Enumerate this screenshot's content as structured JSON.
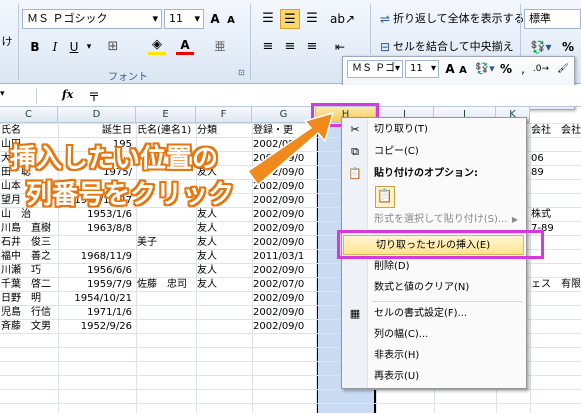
{
  "ribbon": {
    "font_name": "ＭＳ Ｐゴシック",
    "font_size": "11",
    "font_group_label": "フォント",
    "wrap_text_label": "折り返して全体を表示する",
    "merge_center_label": "セルを結合して中央揃え",
    "number_format": "標準",
    "bold": "B",
    "italic": "I",
    "underline": "U",
    "grow_font": "A",
    "shrink_font": "A",
    "font_color_glyph": "A",
    "side_label": "け"
  },
  "formula_bar": {
    "fx": "fx",
    "content": "〒"
  },
  "columns": [
    "C",
    "D",
    "E",
    "F",
    "G",
    "H",
    "I",
    "J",
    "K"
  ],
  "rows": [
    {
      "c": "氏名",
      "d": "誕生日",
      "e": "氏名(連名1)",
      "f": "分類",
      "g": "登録・更",
      "i": "",
      "k": "会社",
      "k2": "会社"
    },
    {
      "c": "山田",
      "d": "195",
      "e": "",
      "f": "",
      "g": "2002/09/0",
      "i": "",
      "k": "",
      "k2": ""
    },
    {
      "c": "大竹",
      "d": "",
      "e": "",
      "f": "",
      "g": "2002/09/0",
      "i": "",
      "k": "06",
      "k2": ""
    },
    {
      "c": "田　聡",
      "d": "1975/",
      "e": "",
      "f": "友人",
      "g": "2002/09/0",
      "i": "",
      "k": "89",
      "k2": ""
    },
    {
      "c": "山本",
      "d": "",
      "e": "",
      "f": "",
      "g": "2002/09/0",
      "i": "",
      "k": "",
      "k2": ""
    },
    {
      "c": "望月",
      "d": "1972/12/27",
      "e": "",
      "f": "",
      "g": "2002/09/0",
      "i": "",
      "k": "",
      "k2": ""
    },
    {
      "c": "山　治",
      "d": "1953/1/6",
      "e": "",
      "f": "友人",
      "g": "2002/09/0",
      "i": "",
      "k": "株式",
      "k2": ""
    },
    {
      "c": "川島　直樹",
      "d": "1963/8/8",
      "e": "",
      "f": "友人",
      "g": "2002/09/0",
      "i": "",
      "k": "7-89",
      "k2": ""
    },
    {
      "c": "石井　俊三",
      "d": "",
      "e": "美子",
      "f": "友人",
      "g": "2002/09/0",
      "i": "",
      "k": "",
      "k2": ""
    },
    {
      "c": "福中　善之",
      "d": "1968/11/9",
      "e": "",
      "f": "友人",
      "g": "2011/03/1",
      "i": "",
      "k": "",
      "k2": ""
    },
    {
      "c": "川瀬　巧",
      "d": "1956/6/6",
      "e": "",
      "f": "友人",
      "g": "2002/09/0",
      "i": "",
      "k": "",
      "k2": ""
    },
    {
      "c": "千葉　啓二",
      "d": "1959/7/9",
      "e": "佐藤　忠司",
      "f": "友人",
      "g": "2002/07/0",
      "i": "",
      "k": "ェス",
      "k2": "有限"
    },
    {
      "c": "日野　明",
      "d": "1954/10/21",
      "e": "",
      "f": "",
      "g": "2002/09/0",
      "i": "",
      "k": "",
      "k2": ""
    },
    {
      "c": "児島　行信",
      "d": "1971/1/6",
      "e": "",
      "f": "",
      "g": "2002/09/0",
      "i": "",
      "k": "",
      "k2": ""
    },
    {
      "c": "斉藤　文男",
      "d": "1952/9/26",
      "e": "",
      "f": "",
      "g": "2002/09/0",
      "i": "",
      "k": "",
      "k2": ""
    }
  ],
  "menu": {
    "cut": "切り取り(T)",
    "copy": "コピー(C)",
    "paste_options": "貼り付けのオプション:",
    "paste_special": "形式を選択して貼り付け(S)...",
    "insert_cut": "切り取ったセルの挿入(E)",
    "delete": "削除(D)",
    "clear": "数式と値のクリア(N)",
    "format_cells": "セルの書式設定(F)...",
    "col_width": "列の幅(C)...",
    "hide": "非表示(H)",
    "unhide": "再表示(U)"
  },
  "mini_toolbar": {
    "font_name": "ＭＳ Ｐゴ",
    "font_size": "11",
    "bold": "B",
    "italic": "I"
  },
  "callout": {
    "line1": "挿入したい位置の",
    "line2": "列番号をクリック"
  },
  "colors": {
    "highlight": "#d63adf",
    "arrow": "#f08a1c",
    "selected_column": "#c9dbf2"
  }
}
